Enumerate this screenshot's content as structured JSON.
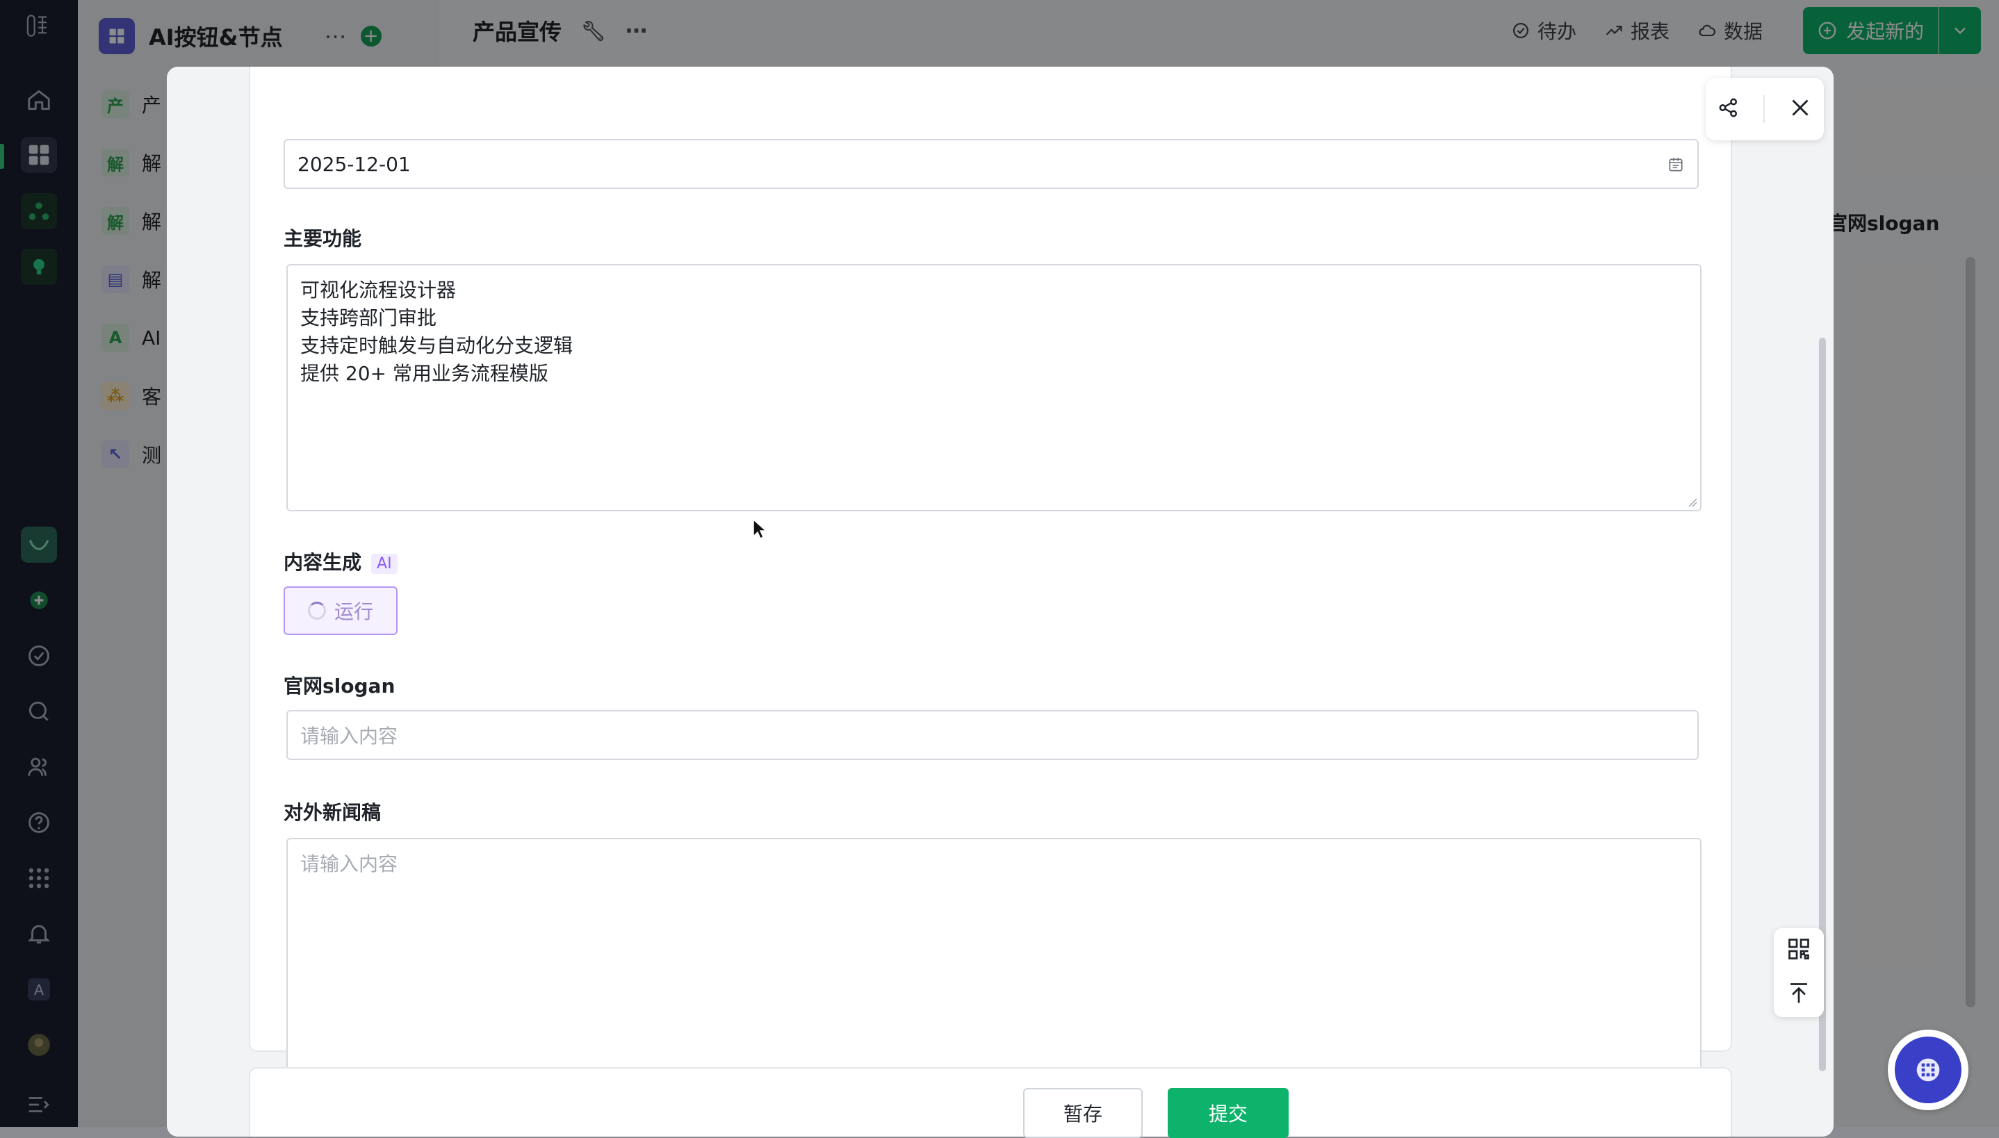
{
  "app": {
    "sidebar_title": "AI按钮&节点",
    "sidebar_items": [
      {
        "icon_text": "产",
        "label": "产",
        "color": "#31a354",
        "bg": "#daf1e1"
      },
      {
        "icon_text": "解",
        "label": "解",
        "color": "#31a354",
        "bg": "#daf1e1"
      },
      {
        "icon_text": "解",
        "label": "解",
        "color": "#31a354",
        "bg": "#daf1e1"
      },
      {
        "icon_text": "",
        "label": "解",
        "color": "#5b5fd6",
        "bg": "#e4e5fb"
      },
      {
        "icon_text": "A",
        "label": "AI",
        "color": "#31a354",
        "bg": "#daf1e1"
      },
      {
        "icon_text": "",
        "label": "客",
        "color": "#e0a020",
        "bg": "#fcefd2"
      },
      {
        "icon_text": "",
        "label": "测",
        "color": "#5b5fd6",
        "bg": "#e4e5fb"
      }
    ],
    "page_title": "产品宣传",
    "top_actions": {
      "todo": "待办",
      "report": "报表",
      "data": "数据"
    },
    "launch_label": "发起新的",
    "bg_column_header": "官网slogan"
  },
  "form": {
    "date_value": "2025-12-01",
    "features_label": "主要功能",
    "features_lines": [
      "可视化流程设计器",
      "支持跨部门审批",
      "支持定时触发与自动化分支逻辑",
      "提供 20+ 常用业务流程模版"
    ],
    "content_gen_label": "内容生成",
    "ai_badge": "AI",
    "run_label": "运行",
    "slogan_label": "官网slogan",
    "slogan_placeholder": "请输入内容",
    "press_label": "对外新闻稿",
    "press_placeholder": "请输入内容"
  },
  "footer": {
    "save_label": "暂存",
    "submit_label": "提交"
  },
  "colors": {
    "primary_green": "#0db36a",
    "ai_purple": "#8a5cf6",
    "rail_bg": "#1a1f2e"
  }
}
